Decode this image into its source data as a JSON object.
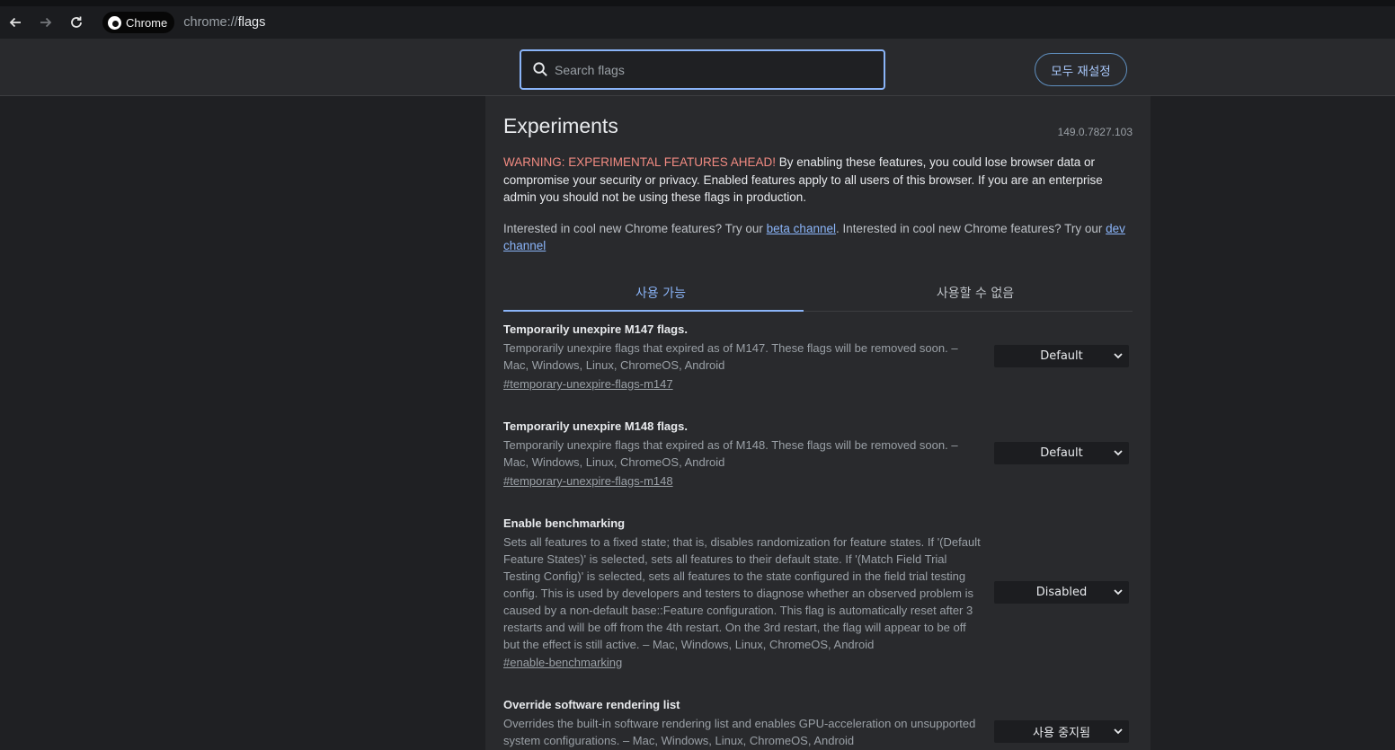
{
  "browser": {
    "chip_label": "Chrome",
    "url_scheme": "chrome://",
    "url_path": "flags"
  },
  "header": {
    "search_placeholder": "Search flags",
    "reset_label": "모두 재설정"
  },
  "page": {
    "title": "Experiments",
    "version": "149.0.7827.103",
    "warning_prefix": "WARNING: EXPERIMENTAL FEATURES AHEAD!",
    "warning_body": " By enabling these features, you could lose browser data or compromise your security or privacy. Enabled features apply to all users of this browser. If you are an enterprise admin you should not be using these flags in production.",
    "interest_1": "Interested in cool new Chrome features? Try our ",
    "beta_link": "beta channel",
    "interest_2": ". Interested in cool new Chrome features? Try our ",
    "dev_link": "dev channel"
  },
  "tabs": [
    {
      "label": "사용 가능",
      "active": true
    },
    {
      "label": "사용할 수 없음",
      "active": false
    }
  ],
  "flags": [
    {
      "name": "Temporarily unexpire M147 flags.",
      "description": "Temporarily unexpire flags that expired as of M147. These flags will be removed soon. – Mac, Windows, Linux, ChromeOS, Android",
      "link": "#temporary-unexpire-flags-m147",
      "value": "Default"
    },
    {
      "name": "Temporarily unexpire M148 flags.",
      "description": "Temporarily unexpire flags that expired as of M148. These flags will be removed soon. – Mac, Windows, Linux, ChromeOS, Android",
      "link": "#temporary-unexpire-flags-m148",
      "value": "Default"
    },
    {
      "name": "Enable benchmarking",
      "description": "Sets all features to a fixed state; that is, disables randomization for feature states. If '(Default Feature States)' is selected, sets all features to their default state. If '(Match Field Trial Testing Config)' is selected, sets all features to the state configured in the field trial testing config. This is used by developers and testers to diagnose whether an observed problem is caused by a non-default base::Feature configuration. This flag is automatically reset after 3 restarts and will be off from the 4th restart. On the 3rd restart, the flag will appear to be off but the effect is still active. – Mac, Windows, Linux, ChromeOS, Android",
      "link": "#enable-benchmarking",
      "value": "Disabled"
    },
    {
      "name": "Override software rendering list",
      "description": "Overrides the built-in software rendering list and enables GPU-acceleration on unsupported system configurations. – Mac, Windows, Linux, ChromeOS, Android",
      "link": "",
      "value": "사용 중지됨"
    }
  ],
  "icons": {
    "back": "arrow-left-icon",
    "forward": "arrow-right-icon",
    "reload": "reload-icon",
    "search": "search-icon",
    "dropdown": "chevron-down-icon"
  },
  "colors": {
    "accent": "#8ab4f8",
    "warning": "#f28b82",
    "page_bg": "#1f2023",
    "panel_bg": "#292a2d"
  }
}
